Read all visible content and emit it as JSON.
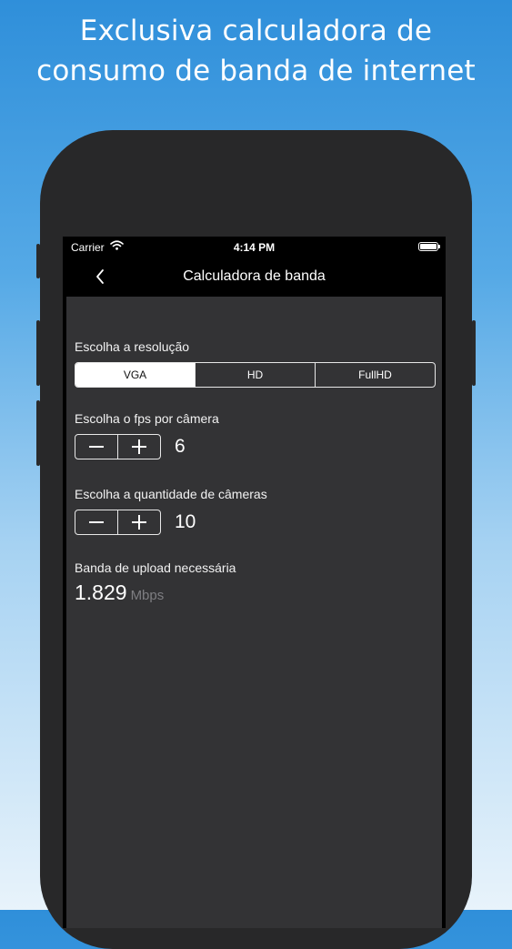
{
  "headline": {
    "line1": "Exclusiva calculadora de",
    "line2": "consumo de banda de internet"
  },
  "status_bar": {
    "carrier": "Carrier",
    "time": "4:14 PM"
  },
  "nav": {
    "title": "Calculadora de banda",
    "back_icon": "chevron-left-icon"
  },
  "resolution": {
    "label": "Escolha a resolução",
    "options": [
      "VGA",
      "HD",
      "FullHD"
    ],
    "selected": "VGA"
  },
  "fps": {
    "label": "Escolha o fps por câmera",
    "value": "6"
  },
  "cameras": {
    "label": "Escolha a quantidade de câmeras",
    "value": "10"
  },
  "upload": {
    "label": "Banda de upload necessária",
    "value": "1.829",
    "unit": "Mbps"
  },
  "colors": {
    "background_top": "#2f8fda",
    "background_bottom": "#e8f3fb",
    "phone_body": "#282829",
    "content_bg": "#333335",
    "unit_text": "#7e7e82"
  }
}
